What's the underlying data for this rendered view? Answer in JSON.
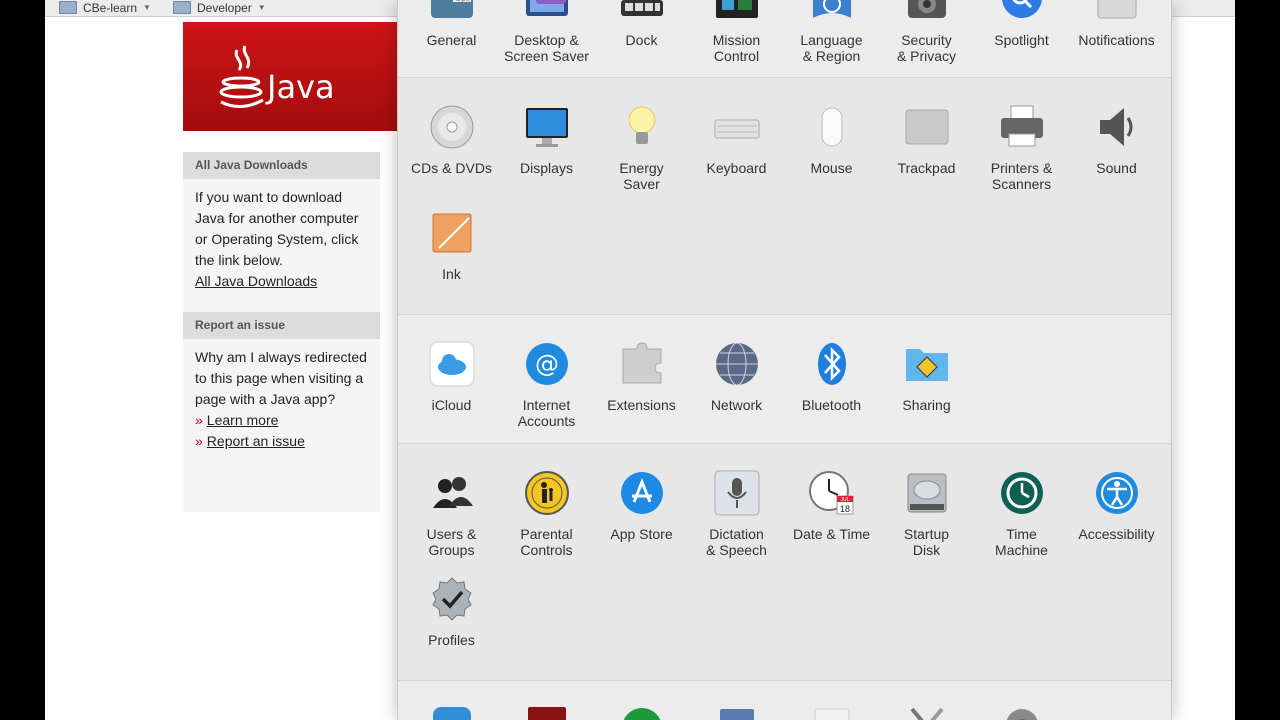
{
  "bookmarks": [
    {
      "label": "CBe-learn"
    },
    {
      "label": "Developer"
    }
  ],
  "java": {
    "logo_text": "Java",
    "downloads_heading": "All Java Downloads",
    "downloads_text": "If you want to download Java for another computer or Operating System, click the link below.",
    "downloads_link": "All Java Downloads",
    "issue_heading": "Report an issue",
    "issue_text": "Why am I always redirected to this page when visiting a page with a Java app?",
    "learn_more": "Learn more",
    "report_link": "Report an issue"
  },
  "prefs": {
    "row1": [
      {
        "label": "General",
        "icon": "general-icon"
      },
      {
        "label": "Desktop &\nScreen Saver",
        "icon": "desktop-screensaver-icon"
      },
      {
        "label": "Dock",
        "icon": "dock-icon"
      },
      {
        "label": "Mission\nControl",
        "icon": "mission-control-icon"
      },
      {
        "label": "Language\n& Region",
        "icon": "language-region-icon"
      },
      {
        "label": "Security\n& Privacy",
        "icon": "security-privacy-icon"
      },
      {
        "label": "Spotlight",
        "icon": "spotlight-icon"
      },
      {
        "label": "Notifications",
        "icon": "notifications-icon"
      }
    ],
    "hardware": [
      {
        "label": "CDs & DVDs",
        "icon": "cd-dvd-icon"
      },
      {
        "label": "Displays",
        "icon": "displays-icon"
      },
      {
        "label": "Energy\nSaver",
        "icon": "energy-saver-icon"
      },
      {
        "label": "Keyboard",
        "icon": "keyboard-icon"
      },
      {
        "label": "Mouse",
        "icon": "mouse-icon"
      },
      {
        "label": "Trackpad",
        "icon": "trackpad-icon"
      },
      {
        "label": "Printers &\nScanners",
        "icon": "printers-scanners-icon"
      },
      {
        "label": "Sound",
        "icon": "sound-icon"
      },
      {
        "label": "Ink",
        "icon": "ink-icon"
      }
    ],
    "internet": [
      {
        "label": "iCloud",
        "icon": "icloud-icon"
      },
      {
        "label": "Internet\nAccounts",
        "icon": "internet-accounts-icon"
      },
      {
        "label": "Extensions",
        "icon": "extensions-icon"
      },
      {
        "label": "Network",
        "icon": "network-icon"
      },
      {
        "label": "Bluetooth",
        "icon": "bluetooth-icon"
      },
      {
        "label": "Sharing",
        "icon": "sharing-icon"
      }
    ],
    "system": [
      {
        "label": "Users &\nGroups",
        "icon": "users-groups-icon"
      },
      {
        "label": "Parental\nControls",
        "icon": "parental-controls-icon"
      },
      {
        "label": "App Store",
        "icon": "app-store-icon"
      },
      {
        "label": "Dictation\n& Speech",
        "icon": "dictation-speech-icon"
      },
      {
        "label": "Date & Time",
        "icon": "date-time-icon"
      },
      {
        "label": "Startup\nDisk",
        "icon": "startup-disk-icon"
      },
      {
        "label": "Time\nMachine",
        "icon": "time-machine-icon"
      },
      {
        "label": "Accessibility",
        "icon": "accessibility-icon"
      },
      {
        "label": "Profiles",
        "icon": "profiles-icon"
      }
    ],
    "calendar_day": "18",
    "calendar_month": "JUL"
  }
}
